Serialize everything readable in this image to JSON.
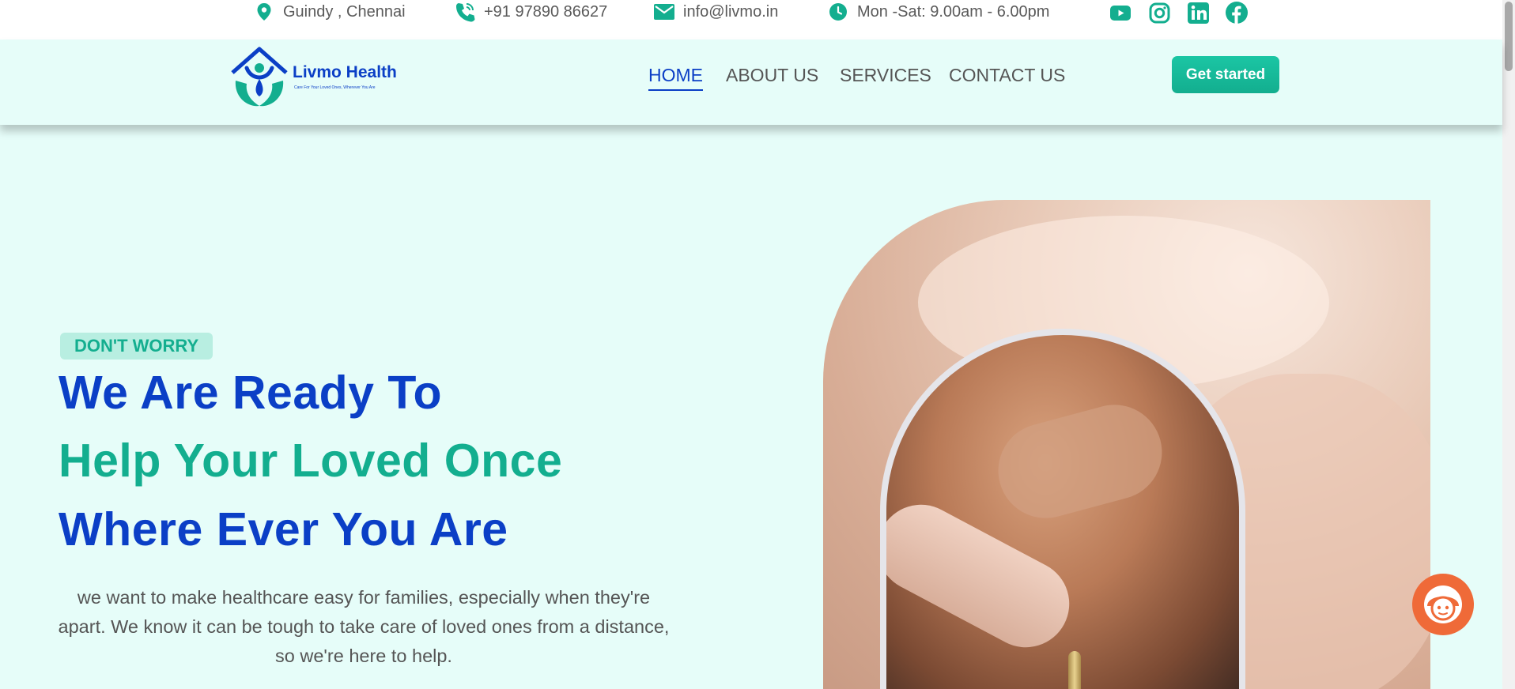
{
  "topbar": {
    "location": "Guindy , Chennai",
    "phone": "+91 97890 86627",
    "email": "info@livmo.in",
    "hours": "Mon -Sat: 9.00am - 6.00pm",
    "socials": [
      "youtube-icon",
      "instagram-icon",
      "linkedin-icon",
      "facebook-icon"
    ]
  },
  "header": {
    "logo_name": "Livmo Health",
    "logo_tagline": "Care For Your Loved Ones, Wherever You Are",
    "nav": [
      "HOME",
      "ABOUT US",
      "SERVICES",
      "CONTACT US"
    ],
    "active_nav": "HOME",
    "cta_label": "Get started"
  },
  "hero": {
    "badge": "DON'T WORRY",
    "headline_1": "We Are Ready To",
    "headline_2": "Help Your Loved Once",
    "headline_3": "Where Ever You Are",
    "description": "we want to make healthcare easy for families, especially when they're apart. We know it can be tough to take care of loved ones from a distance, so we're here to help."
  },
  "colors": {
    "primary_blue": "#0b3fc6",
    "accent_teal": "#13ae8f",
    "page_bg": "#e6fdf9",
    "chat_orange": "#ef6a38"
  }
}
